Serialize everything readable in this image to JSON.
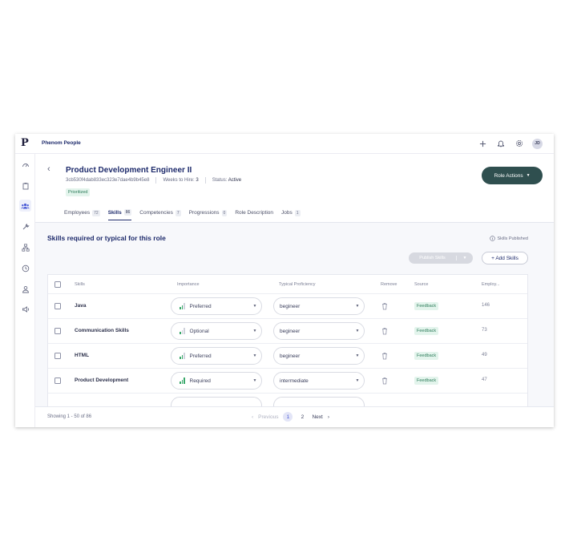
{
  "topbar": {
    "logo": "P",
    "brand": "Phenom People",
    "avatar": "JD"
  },
  "header": {
    "back": "‹",
    "title": "Product Development Engineer II",
    "id": "3cb530f4dab833ec323e7dae4b9b45e8",
    "weeks_label": "Weeks to Hire:",
    "weeks_value": "3",
    "status_label": "Status:",
    "status_value": "Active",
    "tag": "Prioritized",
    "role_actions": "Role Actions"
  },
  "tabs": [
    {
      "label": "Employees",
      "count": "72"
    },
    {
      "label": "Skills",
      "count": "86"
    },
    {
      "label": "Competencies",
      "count": "7"
    },
    {
      "label": "Progressions",
      "count": "0"
    },
    {
      "label": "Role Description",
      "count": ""
    },
    {
      "label": "Jobs",
      "count": "1"
    }
  ],
  "content": {
    "title": "Skills required or typical for this role",
    "published": "Skills Published",
    "publish_button": "Publish Skills",
    "add_button": "+ Add Skills"
  },
  "table": {
    "headers": {
      "skills": "Skills",
      "importance": "Importance",
      "proficiency": "Typical Proficiency",
      "remove": "Remove",
      "source": "Source",
      "employees": "Employ..."
    },
    "rows": [
      {
        "skill": "Java",
        "importance": "Preferred",
        "proficiency": "begineer",
        "source": "Feedback",
        "employees": "146"
      },
      {
        "skill": "Communication Skills",
        "importance": "Optional",
        "proficiency": "begineer",
        "source": "Feedback",
        "employees": "73"
      },
      {
        "skill": "HTML",
        "importance": "Preferred",
        "proficiency": "begineer",
        "source": "Feedback",
        "employees": "49"
      },
      {
        "skill": "Product Development",
        "importance": "Required",
        "proficiency": "intermediate",
        "source": "Feedback",
        "employees": "47"
      }
    ]
  },
  "footer": {
    "showing": "Showing 1 - 50  of  86",
    "previous": "Previous",
    "page1": "1",
    "page2": "2",
    "next": "Next"
  },
  "colors": {
    "accent": "#1d2a6b",
    "role_button": "#2f4f4f",
    "source_tag": "#e3f4ec",
    "importance_bar": "#3aa86b"
  }
}
